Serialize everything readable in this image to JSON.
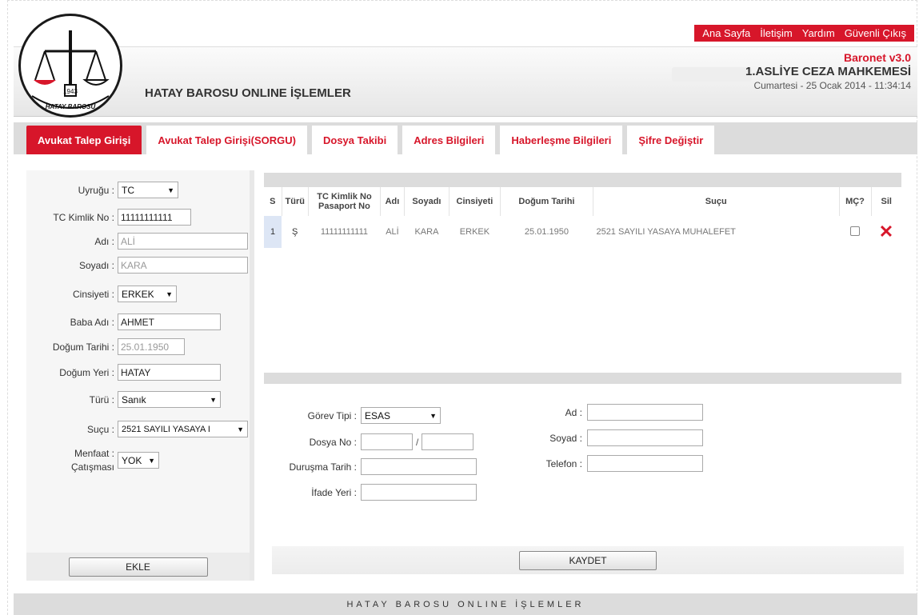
{
  "topnav": [
    "Ana Sayfa",
    "İletişim",
    "Yardım",
    "Güvenli Çıkış"
  ],
  "header": {
    "site_title": "HATAY BAROSU ONLINE İŞLEMLER",
    "version": "Baronet v3.0",
    "court": "1.ASLİYE CEZA MAHKEMESİ",
    "datetime": "Cumartesi - 25 Ocak 2014 - 11:34:14",
    "logo_text": "HATAY BAROSU",
    "logo_year": "1943"
  },
  "tabs": [
    {
      "label": "Avukat Talep Girişi",
      "active": true
    },
    {
      "label": "Avukat Talep Girişi(SORGU)"
    },
    {
      "label": "Dosya Takibi"
    },
    {
      "label": "Adres Bilgileri"
    },
    {
      "label": "Haberleşme Bilgileri"
    },
    {
      "label": "Şifre Değiştir"
    }
  ],
  "left_form": {
    "uyrugu_label": "Uyruğu :",
    "uyrugu_value": "TC",
    "tc_label": "TC Kimlik No :",
    "tc_value": "11111111111",
    "adi_label": "Adı :",
    "adi_value": "ALİ",
    "soyadi_label": "Soyadı :",
    "soyadi_value": "KARA",
    "cinsiyeti_label": "Cinsiyeti :",
    "cinsiyeti_value": "ERKEK",
    "baba_label": "Baba Adı :",
    "baba_value": "AHMET",
    "dogum_tarihi_label": "Doğum Tarihi :",
    "dogum_tarihi_value": "25.01.1950",
    "dogum_yeri_label": "Doğum Yeri :",
    "dogum_yeri_value": "HATAY",
    "turu_label": "Türü :",
    "turu_value": "Sanık",
    "sucu_label": "Suçu :",
    "sucu_value": "2521 SAYILI YASAYA I",
    "menfaat_label": "Menfaat :",
    "menfaat_label2": "Çatışması",
    "menfaat_value": "YOK",
    "ekle_button": "EKLE"
  },
  "table": {
    "headers": [
      "S",
      "Türü",
      "TC Kimlik No Pasaport No",
      "Adı",
      "Soyadı",
      "Cinsiyeti",
      "Doğum Tarihi",
      "Suçu",
      "MÇ?",
      "Sil"
    ],
    "rows": [
      {
        "s": "1",
        "turu": "Ş",
        "tc": "11111111111",
        "adi": "ALİ",
        "soyadi": "KARA",
        "cinsiyeti": "ERKEK",
        "dogum": "25.01.1950",
        "sucu": "2521 SAYILI YASAYA MUHALEFET"
      }
    ]
  },
  "bottom_form": {
    "gorev_label": "Görev Tipi :",
    "gorev_value": "ESAS",
    "dosya_label": "Dosya No :",
    "dosya_sep": "/",
    "durusma_label": "Duruşma Tarih :",
    "ifade_label": "İfade Yeri :",
    "ad_label": "Ad :",
    "soyad_label": "Soyad :",
    "telefon_label": "Telefon :",
    "kaydet_button": "KAYDET"
  },
  "footer": "HATAY BAROSU ONLINE İŞLEMLER",
  "colors": {
    "accent": "#d7162a",
    "band": "#dcdcdc"
  },
  "icons": {
    "delete": "red-x-icon"
  }
}
